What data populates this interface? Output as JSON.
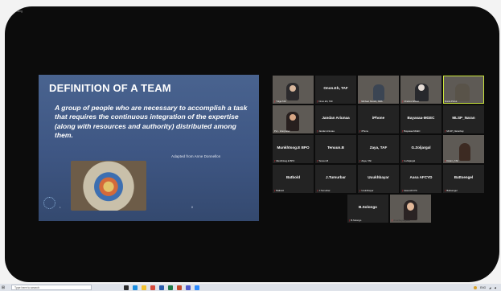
{
  "meeting": {
    "recording_label": "Recording"
  },
  "slide": {
    "title": "DEFINITION OF A TEAM",
    "body": "A group of people who are necessary to accomplish a task that requires the continuous integration of the expertise (along with resources and authority) distributed among them.",
    "credit": "Adapted from Anne Donnellon",
    "footer": "1",
    "page": "8"
  },
  "participants": [
    {
      "name": "",
      "label": "Tulga TAF"
    },
    {
      "name": "Onon.Eh, TAF",
      "label": "Onon.Eh, TAF"
    },
    {
      "name": "",
      "label": "Michael Novick, NDA"
    },
    {
      "name": "",
      "label": "Charles Wilson"
    },
    {
      "name": "",
      "label": "Dunia Pohul"
    },
    {
      "name": "",
      "label": "Pur - interpreter"
    },
    {
      "name": "Jandan Ariunaa",
      "label": "Jandan Ariunaa"
    },
    {
      "name": "iPhone",
      "label": "iPhone"
    },
    {
      "name": "Bayasaa-MGEC",
      "label": "Bayasaa-MGEC"
    },
    {
      "name": "MLSP_Naran",
      "label": "MLSP_Naranbay"
    },
    {
      "name": "Munkhtsog.E BPO",
      "label": "Munkhtsog.E BPO"
    },
    {
      "name": "Tenuun.B",
      "label": "Tenuun.B"
    },
    {
      "name": "Zaya, TAF",
      "label": "Zaya, TAF"
    },
    {
      "name": "G.Zoljargal",
      "label": "G.Zoljargal"
    },
    {
      "name": "",
      "label": "Dulam_TAF"
    },
    {
      "name": "Batbold",
      "label": "Batbold"
    },
    {
      "name": "J.Tumurbar",
      "label": "J.Tumurbar"
    },
    {
      "name": "Uuukhbayar",
      "label": "Uuukhbayar"
    },
    {
      "name": "Aasa AFCYD",
      "label": "Aasa AFCYD"
    },
    {
      "name": "Battsengel",
      "label": "Battsengel"
    },
    {
      "name": "B.Solongo",
      "label": "B.Solongo"
    },
    {
      "name": "",
      "label": "Amarbayasgalan"
    }
  ],
  "taskbar": {
    "search_placeholder": "Type here to search",
    "tray_text": "ENG"
  },
  "colors": {
    "active_speaker": "#c9e33c",
    "mic_off": "#e0303a",
    "tile_bg": "#232323"
  }
}
